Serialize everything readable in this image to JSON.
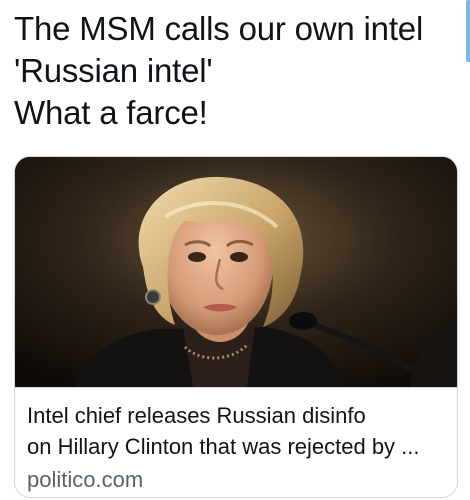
{
  "tweet": {
    "lines": [
      "The MSM calls our own intel",
      "'Russian intel'",
      "What a farce!"
    ]
  },
  "card": {
    "title_lines": [
      "Intel chief releases Russian disinfo",
      "on Hillary Clinton that was rejected by ..."
    ],
    "domain": "politico.com",
    "image_icon": "news-photo"
  },
  "colors": {
    "text": "#0f1419",
    "secondary": "#536471",
    "border": "#cfd9de",
    "scroll_accent": "#79b7e9"
  }
}
